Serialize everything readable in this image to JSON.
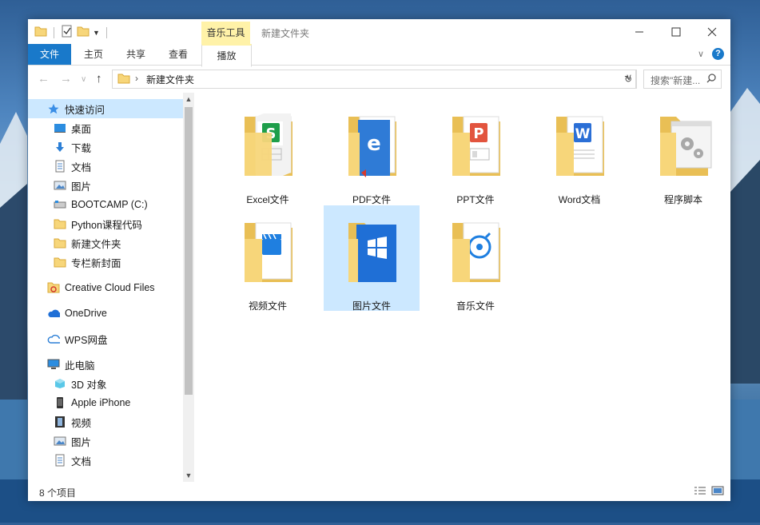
{
  "window": {
    "title": "新建文件夹",
    "contextual_tab_header": "音乐工具"
  },
  "ribbon": {
    "tabs": [
      "文件",
      "主页",
      "共享",
      "查看",
      "播放"
    ]
  },
  "address": {
    "path": "新建文件夹",
    "search_placeholder": "搜索\"新建..."
  },
  "nav": {
    "items": [
      {
        "label": "快速访问",
        "icon": "star-icon",
        "pinned": false,
        "selected": true
      },
      {
        "label": "桌面",
        "icon": "desktop-icon",
        "pinned": true
      },
      {
        "label": "下载",
        "icon": "download-arrow-icon",
        "pinned": true
      },
      {
        "label": "文档",
        "icon": "document-icon",
        "pinned": true
      },
      {
        "label": "图片",
        "icon": "picture-icon",
        "pinned": true
      },
      {
        "label": "BOOTCAMP (C:)",
        "icon": "drive-icon",
        "pinned": false
      },
      {
        "label": "Python课程代码",
        "icon": "folder-icon",
        "pinned": false
      },
      {
        "label": "新建文件夹",
        "icon": "folder-icon",
        "pinned": false
      },
      {
        "label": "专栏新封面",
        "icon": "folder-icon",
        "pinned": false
      },
      {
        "label": "Creative Cloud Files",
        "icon": "creative-cloud-icon",
        "pinned": false
      },
      {
        "label": "OneDrive",
        "icon": "onedrive-cloud-icon",
        "pinned": false
      },
      {
        "label": "WPS网盘",
        "icon": "wps-cloud-icon",
        "pinned": false
      },
      {
        "label": "此电脑",
        "icon": "computer-icon",
        "pinned": false
      },
      {
        "label": "3D 对象",
        "icon": "3d-objects-icon",
        "pinned": false
      },
      {
        "label": "Apple iPhone",
        "icon": "phone-icon",
        "pinned": false
      },
      {
        "label": "视频",
        "icon": "video-icon",
        "pinned": false
      },
      {
        "label": "图片",
        "icon": "picture-icon",
        "pinned": false
      },
      {
        "label": "文档",
        "icon": "document-icon",
        "pinned": false
      }
    ]
  },
  "content": {
    "items": [
      {
        "label": "Excel文件",
        "badge": "excel",
        "color": "#1e9e4a"
      },
      {
        "label": "PDF文件",
        "badge": "pdf",
        "color": "#2f7bd6"
      },
      {
        "label": "PPT文件",
        "badge": "ppt",
        "color": "#e2543e"
      },
      {
        "label": "Word文档",
        "badge": "word",
        "color": "#2b6fd6"
      },
      {
        "label": "程序脚本",
        "badge": "gear",
        "color": "#9a9a9a"
      },
      {
        "label": "视频文件",
        "badge": "video",
        "color": "#1f7fe0"
      },
      {
        "label": "图片文件",
        "badge": "windows",
        "color": "#1f6fd6",
        "selected": true
      },
      {
        "label": "音乐文件",
        "badge": "music",
        "color": "#1f7fe0"
      }
    ]
  },
  "status": {
    "count_text": "8 个项目"
  },
  "colors": {
    "accent": "#1979ca",
    "selection": "#cce8ff",
    "folder": "#f7d67a",
    "context_tab": "#fff2a8"
  }
}
